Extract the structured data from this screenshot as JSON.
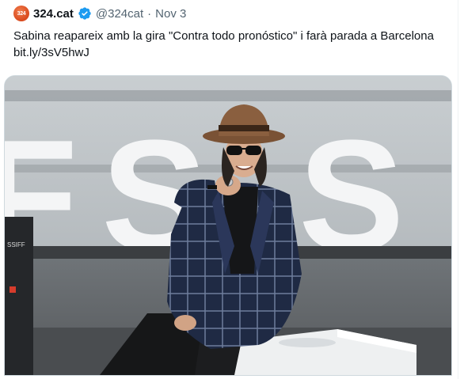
{
  "tweet": {
    "avatar_text": "324",
    "display_name": "324.cat",
    "handle": "@324cat",
    "separator": "·",
    "date": "Nov 3",
    "text": "Sabina reapareix amb la gira \"Contra todo pronóstico\" i farà parada a Barcelona ",
    "link": "bit.ly/3sV5hwJ"
  },
  "media": {
    "backdrop_letters": "FS.S",
    "sign_text": "SSIFF"
  },
  "colors": {
    "verified_blue": "#1d9bf0",
    "avatar_orange": "#e0582a",
    "text_primary": "#0f1419",
    "text_secondary": "#536471",
    "border": "#cfd9de"
  },
  "icons": {
    "verified": "verified-badge-icon",
    "avatar": "publisher-logo-avatar"
  }
}
